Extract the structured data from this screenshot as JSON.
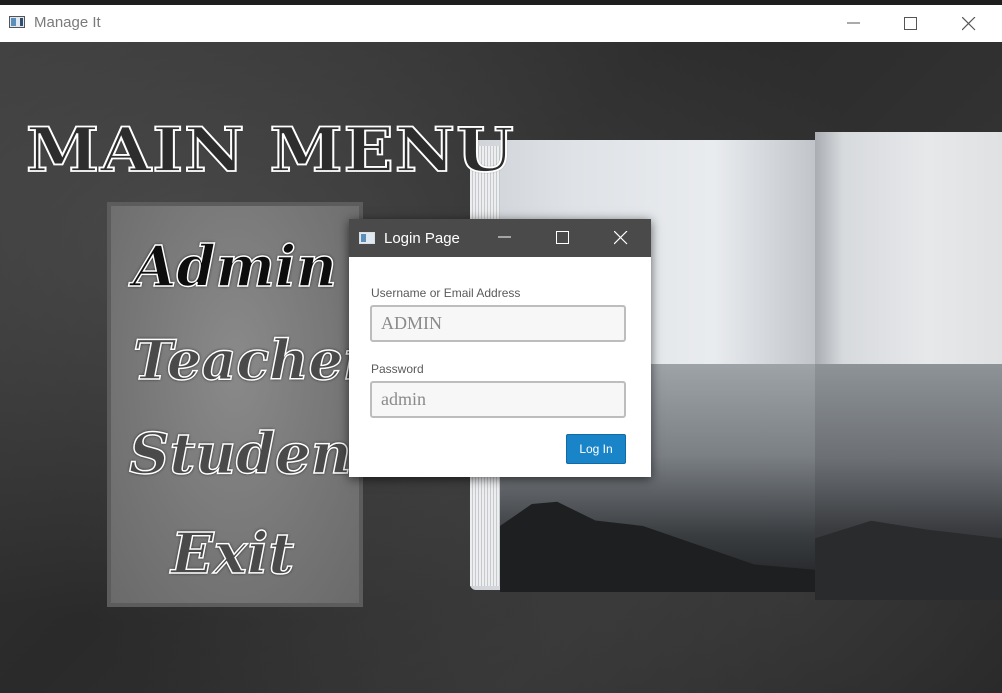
{
  "window": {
    "title": "Manage It",
    "controls": [
      "minimize-icon",
      "maximize-icon",
      "close-icon"
    ]
  },
  "main": {
    "heading": "MAIN MENU",
    "menu": [
      {
        "label": "Admin",
        "selected": true
      },
      {
        "label": "Teacher",
        "selected": false
      },
      {
        "label": "Student",
        "selected": false
      },
      {
        "label": "Exit",
        "selected": false
      }
    ]
  },
  "login_dialog": {
    "title": "Login Page",
    "username_label": "Username or Email Address",
    "username_value": "ADMIN",
    "password_label": "Password",
    "password_value": "admin",
    "submit_label": "Log In"
  },
  "colors": {
    "dialog_titlebar": "#4a4a4a",
    "login_button": "#1a84c8",
    "background": "#2e2e2e"
  }
}
